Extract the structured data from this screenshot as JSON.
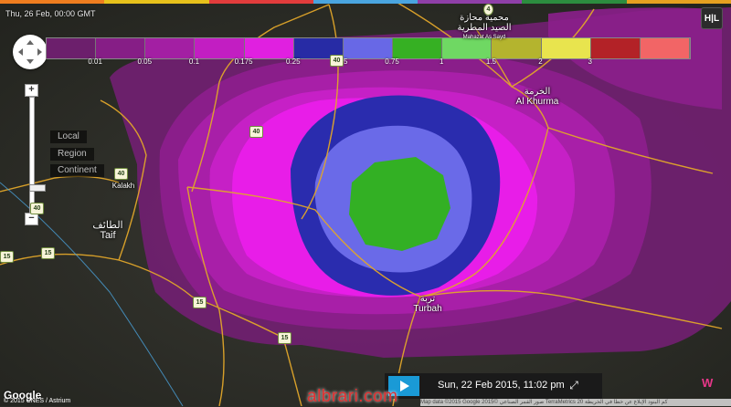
{
  "timestamp": "Thu, 26 Feb, 00:00 GMT",
  "hl_button": "H|L",
  "legend": {
    "swatches": [
      "#6c1f6c",
      "#861e86",
      "#a31fa3",
      "#c21ec2",
      "#e020e0",
      "#272ba5",
      "#6868e6",
      "#36b023",
      "#6fd863",
      "#b4b42e",
      "#e8e44e",
      "#b32227",
      "#f26566"
    ],
    "ticks": [
      "0.01",
      "0.05",
      "0.1",
      "0.175",
      "0.25",
      "0.5",
      "0.75",
      "1",
      "1.5",
      "2",
      "3"
    ]
  },
  "zoom": {
    "plus": "+",
    "minus": "−"
  },
  "zoom_levels": [
    "Local",
    "Region",
    "Continent"
  ],
  "places": {
    "taif_ar": "الطائف",
    "taif": "Taif",
    "khurma_ar": "الخرمة",
    "khurma": "Al Khurma",
    "turbah_ar": "تربة",
    "turbah": "Turbah",
    "mahazat_ar1": "محمية محازة",
    "mahazat_ar2": "الصيد المطرية",
    "mahazat": "Mahazat As Sayd",
    "kalakh": "Kalakh"
  },
  "routes": {
    "r40": "40",
    "r15": "15",
    "r4": "4"
  },
  "player": {
    "play_label": "play",
    "date": "Sun, 22 Feb 2015, 11:02 pm"
  },
  "watermark": "albrari.com",
  "google": "Google",
  "image_src": "© 2015 CNES / Astrium",
  "attribution": "Map data ©2015 Google صور القمر الصناعي ©2015 TerraMetrics  20 كم   البنود  الإبلاغ عن خطأ في الخريطة",
  "colors": {
    "top_stripe": [
      "#ef7d1f",
      "#e7c11b",
      "#e23c3c",
      "#4aa5e0",
      "#8f3fa8",
      "#2c8d3f",
      "#e6a120"
    ]
  }
}
